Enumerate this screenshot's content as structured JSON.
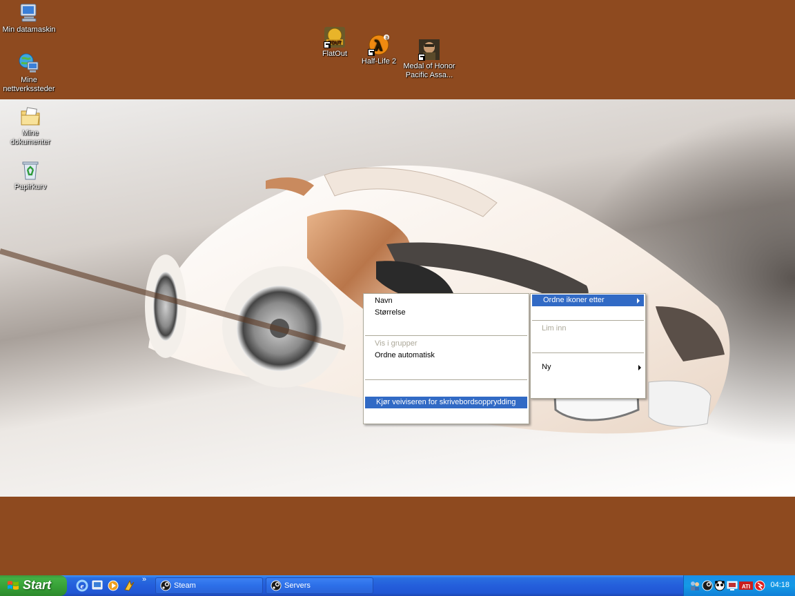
{
  "desktop": {
    "icons": [
      {
        "label": "Min datamaskin"
      },
      {
        "label": "Mine nettverkssteder"
      },
      {
        "label": "Mine dokumenter"
      },
      {
        "label": "Papirkurv"
      },
      {
        "label": "FlatOut"
      },
      {
        "label": "Half-Life 2"
      },
      {
        "label": "Medal of Honor Pacific Assa..."
      }
    ]
  },
  "context_menu": {
    "items": [
      {
        "label": "Navn"
      },
      {
        "label": "Størrelse"
      },
      {
        "label": "Vis i grupper"
      },
      {
        "label": "Ordne automatisk"
      },
      {
        "label": "Kjør veiviseren for skrivebordsopprydding"
      }
    ]
  },
  "submenu": {
    "items": [
      {
        "label": "Ordne ikoner etter"
      },
      {
        "label": "Lim inn"
      },
      {
        "label": "Ny"
      }
    ]
  },
  "taskbar": {
    "start_label": "Start",
    "quicklaunch_chevron": "»",
    "tasks": [
      {
        "label": "Steam"
      },
      {
        "label": "Servers"
      }
    ],
    "tray": {
      "clock": "04:18",
      "ati_label": "ATI"
    }
  },
  "colors": {
    "desktop_background": "#8e4a1f",
    "menu_highlight": "#316ac5",
    "taskbar_blue": "#245edb",
    "start_green": "#3c9a3c"
  }
}
